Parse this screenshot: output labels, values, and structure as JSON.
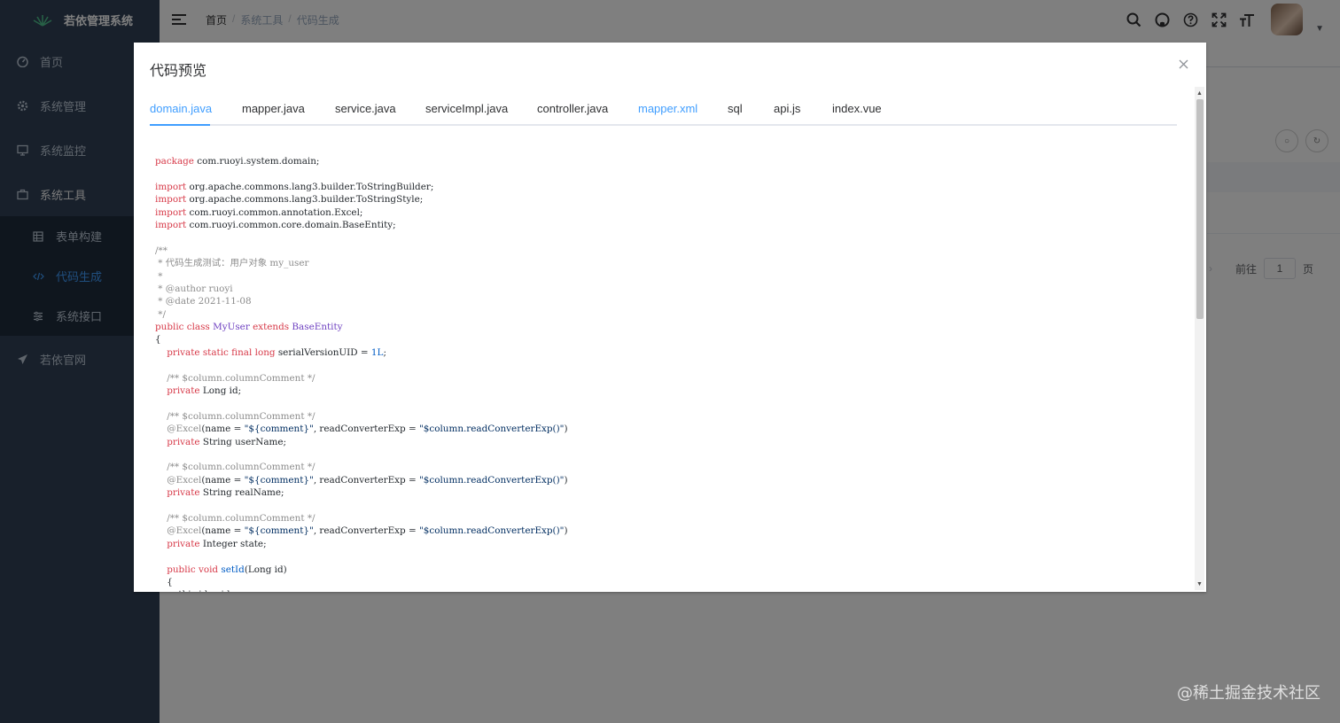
{
  "app": {
    "title": "若依管理系统"
  },
  "sidebar": {
    "items": [
      {
        "label": "首页",
        "icon": "dashboard-icon"
      },
      {
        "label": "系统管理",
        "icon": "gear-icon"
      },
      {
        "label": "系统监控",
        "icon": "monitor-icon"
      },
      {
        "label": "系统工具",
        "icon": "tool-icon"
      }
    ],
    "tools_submenu": [
      {
        "label": "表单构建",
        "icon": "form-icon"
      },
      {
        "label": "代码生成",
        "icon": "code-icon",
        "active": true
      },
      {
        "label": "系统接口",
        "icon": "api-icon"
      }
    ],
    "external": {
      "label": "若依官网",
      "icon": "send-icon"
    }
  },
  "header": {
    "breadcrumb": [
      "首页",
      "系统工具",
      "代码生成"
    ],
    "tools": [
      "search-icon",
      "github-icon",
      "question-icon",
      "fullscreen-icon",
      "font-size-icon"
    ]
  },
  "pager": {
    "goto_label": "前往",
    "page": "1",
    "page_suffix": "页"
  },
  "dialog": {
    "title": "代码预览",
    "tabs": [
      {
        "label": "domain.java",
        "active": true
      },
      {
        "label": "mapper.java"
      },
      {
        "label": "service.java"
      },
      {
        "label": "serviceImpl.java"
      },
      {
        "label": "controller.java"
      },
      {
        "label": "mapper.xml",
        "highlight": true
      },
      {
        "label": "sql"
      },
      {
        "label": "api.js"
      },
      {
        "label": "index.vue"
      }
    ]
  },
  "code": [
    [
      [
        "kw",
        "package"
      ],
      [
        "t",
        " com.ruoyi.system.domain;"
      ]
    ],
    [],
    [
      [
        "kw",
        "import"
      ],
      [
        "t",
        " org.apache.commons.lang3.builder.ToStringBuilder;"
      ]
    ],
    [
      [
        "kw",
        "import"
      ],
      [
        "t",
        " org.apache.commons.lang3.builder.ToStringStyle;"
      ]
    ],
    [
      [
        "kw",
        "import"
      ],
      [
        "t",
        " com.ruoyi.common.annotation.Excel;"
      ]
    ],
    [
      [
        "kw",
        "import"
      ],
      [
        "t",
        " com.ruoyi.common.core.domain.BaseEntity;"
      ]
    ],
    [],
    [
      [
        "cm",
        "/**"
      ]
    ],
    [
      [
        "cm",
        " * 代码生成测试：用户对象 my_user"
      ]
    ],
    [
      [
        "cm",
        " *"
      ]
    ],
    [
      [
        "cm",
        " * @author ruoyi"
      ]
    ],
    [
      [
        "cm",
        " * @date 2021-11-08"
      ]
    ],
    [
      [
        "cm",
        " */"
      ]
    ],
    [
      [
        "kw",
        "public class "
      ],
      [
        "cls",
        "MyUser"
      ],
      [
        "kw",
        " extends "
      ],
      [
        "cls",
        "BaseEntity"
      ]
    ],
    [
      [
        "t",
        "{"
      ]
    ],
    [
      [
        "t",
        "    "
      ],
      [
        "kw",
        "private static final long"
      ],
      [
        "t",
        " serialVersionUID = "
      ],
      [
        "num",
        "1L"
      ],
      [
        "t",
        ";"
      ]
    ],
    [],
    [
      [
        "t",
        "    "
      ],
      [
        "cm",
        "/** $column.columnComment */"
      ]
    ],
    [
      [
        "t",
        "    "
      ],
      [
        "kw",
        "private"
      ],
      [
        "t",
        " Long id;"
      ]
    ],
    [],
    [
      [
        "t",
        "    "
      ],
      [
        "cm",
        "/** $column.columnComment */"
      ]
    ],
    [
      [
        "t",
        "    "
      ],
      [
        "cm",
        "@Excel"
      ],
      [
        "t",
        "(name = "
      ],
      [
        "str",
        "\"${comment}\""
      ],
      [
        "t",
        ", readConverterExp = "
      ],
      [
        "str",
        "\"$column.readConverterExp()\""
      ],
      [
        "t",
        ")"
      ]
    ],
    [
      [
        "t",
        "    "
      ],
      [
        "kw",
        "private"
      ],
      [
        "t",
        " String userName;"
      ]
    ],
    [],
    [
      [
        "t",
        "    "
      ],
      [
        "cm",
        "/** $column.columnComment */"
      ]
    ],
    [
      [
        "t",
        "    "
      ],
      [
        "cm",
        "@Excel"
      ],
      [
        "t",
        "(name = "
      ],
      [
        "str",
        "\"${comment}\""
      ],
      [
        "t",
        ", readConverterExp = "
      ],
      [
        "str",
        "\"$column.readConverterExp()\""
      ],
      [
        "t",
        ")"
      ]
    ],
    [
      [
        "t",
        "    "
      ],
      [
        "kw",
        "private"
      ],
      [
        "t",
        " String realName;"
      ]
    ],
    [],
    [
      [
        "t",
        "    "
      ],
      [
        "cm",
        "/** $column.columnComment */"
      ]
    ],
    [
      [
        "t",
        "    "
      ],
      [
        "cm",
        "@Excel"
      ],
      [
        "t",
        "(name = "
      ],
      [
        "str",
        "\"${comment}\""
      ],
      [
        "t",
        ", readConverterExp = "
      ],
      [
        "str",
        "\"$column.readConverterExp()\""
      ],
      [
        "t",
        ")"
      ]
    ],
    [
      [
        "t",
        "    "
      ],
      [
        "kw",
        "private"
      ],
      [
        "t",
        " Integer state;"
      ]
    ],
    [],
    [
      [
        "t",
        "    "
      ],
      [
        "kw",
        "public void "
      ],
      [
        "fn",
        "setId"
      ],
      [
        "t",
        "(Long id)"
      ]
    ],
    [
      [
        "t",
        "    {"
      ]
    ],
    [
      [
        "t",
        "        this.id = id;"
      ]
    ]
  ],
  "watermark": "@稀土掘金技术社区",
  "colors": {
    "sidebar_bg": "#304156",
    "submenu_bg": "#1f2d3d",
    "accent": "#409eff",
    "keyword": "#d73a49",
    "comment": "#8c8c8c"
  }
}
